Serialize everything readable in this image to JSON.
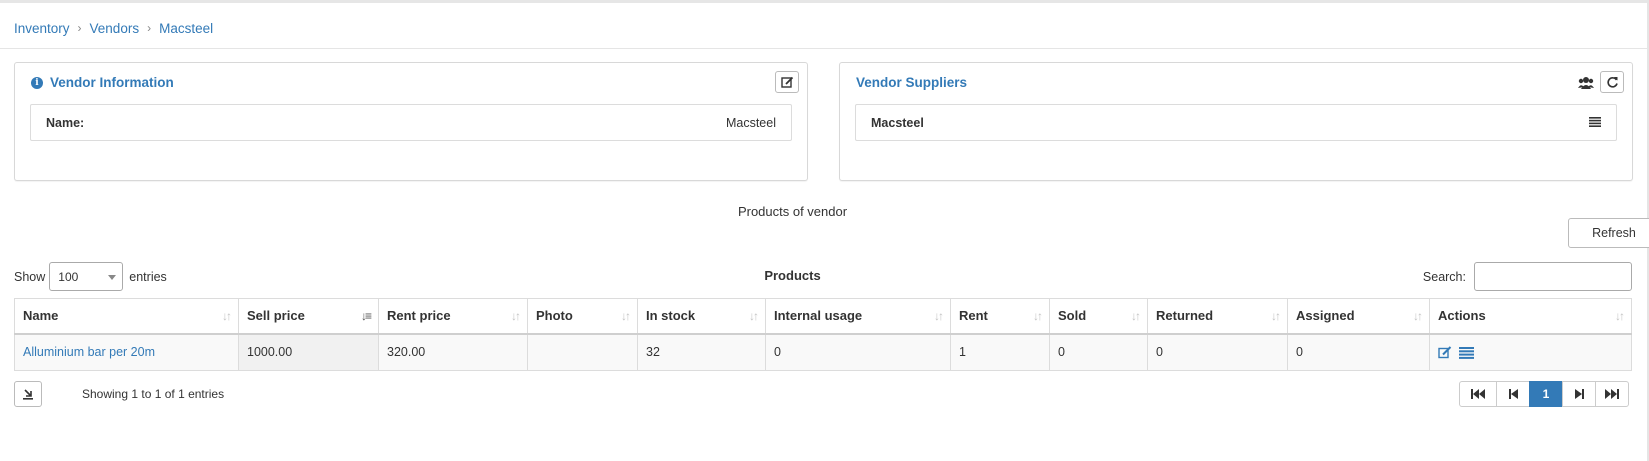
{
  "breadcrumb": {
    "items": [
      "Inventory",
      "Vendors",
      "Macsteel"
    ]
  },
  "vendor_info": {
    "title": "Vendor Information",
    "name_label": "Name:",
    "name_value": "Macsteel"
  },
  "vendor_suppliers": {
    "title": "Vendor Suppliers",
    "items": [
      "Macsteel"
    ]
  },
  "products_section": {
    "title": "Products of vendor",
    "refresh_label": "Refresh",
    "show_label": "Show",
    "entries_label": "entries",
    "length_value": "100",
    "caption": "Products",
    "search_label": "Search:",
    "search_value": "",
    "columns": [
      "Name",
      "Sell price",
      "Rent price",
      "Photo",
      "In stock",
      "Internal usage",
      "Rent",
      "Sold",
      "Returned",
      "Assigned",
      "Actions"
    ],
    "rows": [
      {
        "name": "Alluminium bar per 20m",
        "sell_price": "1000.00",
        "rent_price": "320.00",
        "photo": "",
        "in_stock": "32",
        "internal_usage": "0",
        "rent": "1",
        "sold": "0",
        "returned": "0",
        "assigned": "0"
      }
    ],
    "info_text": "Showing 1 to 1 of 1 entries",
    "current_page": "1"
  },
  "colors": {
    "accent": "#337ab7",
    "border": "#dcdcdc"
  }
}
